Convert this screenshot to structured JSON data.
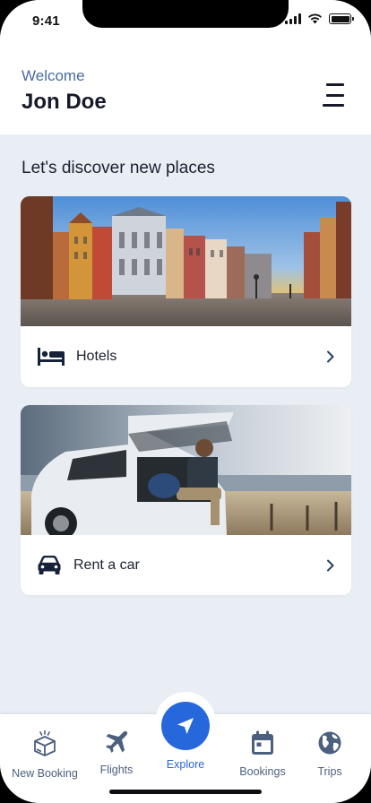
{
  "status": {
    "time": "9:41"
  },
  "header": {
    "welcome": "Welcome",
    "username": "Jon Doe"
  },
  "main": {
    "title": "Let's discover new places",
    "cards": [
      {
        "label": "Hotels",
        "icon": "bed-icon"
      },
      {
        "label": "Rent a car",
        "icon": "car-icon"
      }
    ]
  },
  "nav": {
    "items": [
      {
        "label": "New Booking",
        "icon": "box-icon"
      },
      {
        "label": "Flights",
        "icon": "airplane-icon"
      },
      {
        "label": "Explore",
        "icon": "navigation-arrow-icon"
      },
      {
        "label": "Bookings",
        "icon": "calendar-icon"
      },
      {
        "label": "Trips",
        "icon": "globe-icon"
      }
    ],
    "active": "Explore"
  },
  "colors": {
    "accent": "#2767dc",
    "brand_text": "#4a6aa0",
    "background": "#e9eef4"
  }
}
